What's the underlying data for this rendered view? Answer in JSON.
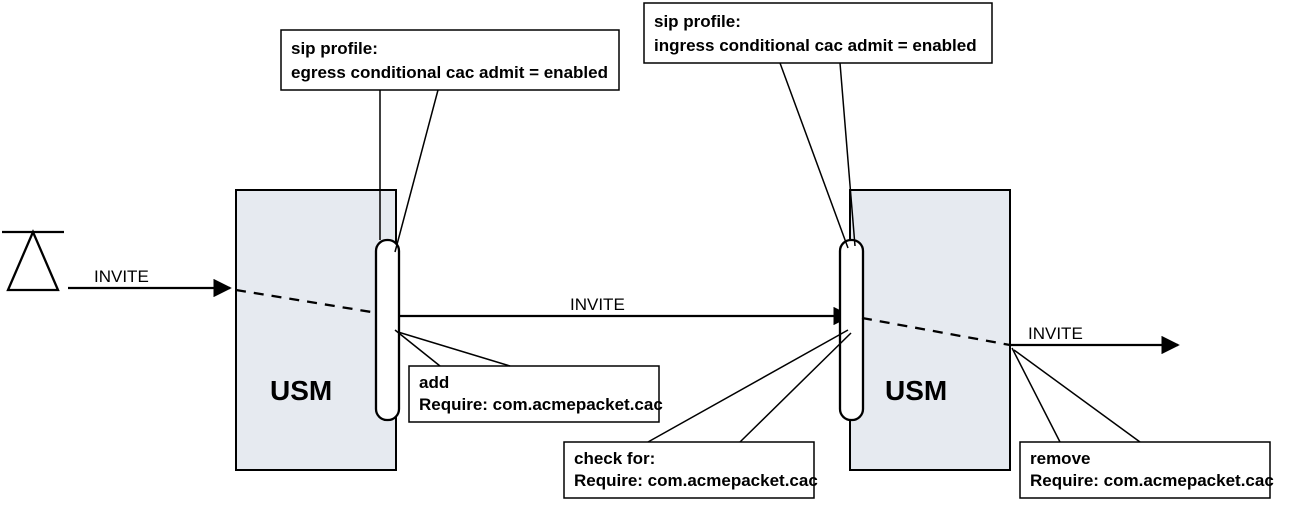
{
  "usm1_label": "USM",
  "usm2_label": "USM",
  "invite1": "INVITE",
  "invite2": "INVITE",
  "invite3": "INVITE",
  "callout_egress": {
    "l1": "sip profile:",
    "l2": "egress conditional cac admit = enabled"
  },
  "callout_add": {
    "l1": "add",
    "l2": "Require: com.acmepacket.cac"
  },
  "callout_ingress": {
    "l1": "sip profile:",
    "l2": "ingress conditional cac admit = enabled"
  },
  "callout_check": {
    "l1": "check for:",
    "l2": "Require: com.acmepacket.cac"
  },
  "callout_remove": {
    "l1": "remove",
    "l2": "Require: com.acmepacket.cac"
  }
}
